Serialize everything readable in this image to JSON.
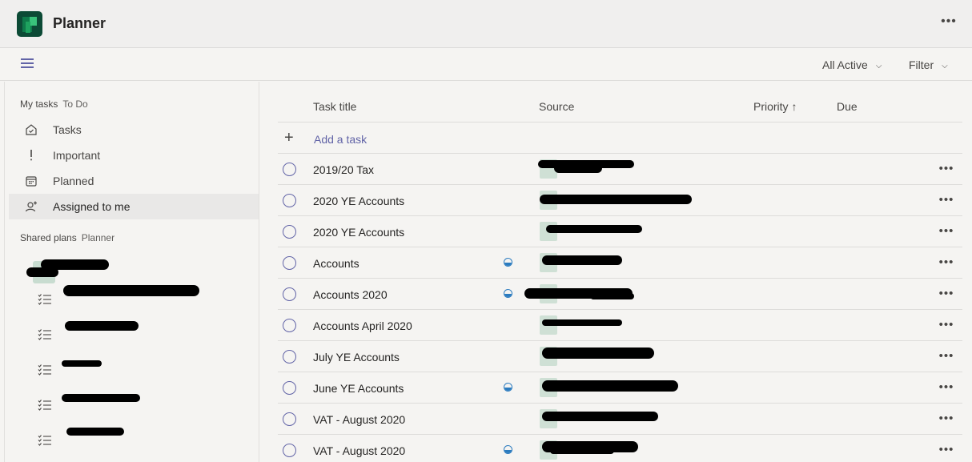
{
  "app": {
    "title": "Planner",
    "more_icon": "more-horizontal-icon",
    "logo_icon": "planner-logo-icon",
    "accent_color": "#6264a7",
    "logo_color": "#0c4a35"
  },
  "toolbar": {
    "menu_icon": "hamburger-icon",
    "filter_active_label": "All Active",
    "filter_label": "Filter",
    "chevron_icon": "chevron-down-icon"
  },
  "sidebar": {
    "my_tasks": {
      "label": "My tasks",
      "sub": "To Do",
      "items": [
        {
          "label": "Tasks",
          "icon": "home-icon",
          "selected": false
        },
        {
          "label": "Important",
          "icon": "exclamation-icon",
          "selected": false
        },
        {
          "label": "Planned",
          "icon": "calendar-icon",
          "selected": false
        },
        {
          "label": "Assigned to me",
          "icon": "person-add-icon",
          "selected": true
        }
      ]
    },
    "shared_plans": {
      "label": "Shared plans",
      "sub": "Planner",
      "items": [
        {
          "icon": "group-avatar"
        },
        {
          "icon": "checklist-icon"
        },
        {
          "icon": "checklist-icon"
        },
        {
          "icon": "checklist-icon"
        },
        {
          "icon": "checklist-icon"
        },
        {
          "icon": "checklist-icon"
        }
      ]
    }
  },
  "table": {
    "headers": {
      "title": "Task title",
      "source": "Source",
      "priority": "Priority ↑",
      "due": "Due"
    },
    "add_task_label": "Add a task",
    "add_icon": "plus-icon",
    "rows": [
      {
        "title": "2019/20 Tax",
        "in_progress": false
      },
      {
        "title": "2020 YE Accounts",
        "in_progress": false
      },
      {
        "title": "2020 YE Accounts",
        "in_progress": false
      },
      {
        "title": "Accounts",
        "in_progress": true
      },
      {
        "title": "Accounts 2020",
        "in_progress": true
      },
      {
        "title": "Accounts April 2020",
        "in_progress": false
      },
      {
        "title": "July YE Accounts",
        "in_progress": false
      },
      {
        "title": "June YE Accounts",
        "in_progress": true
      },
      {
        "title": "VAT - August 2020",
        "in_progress": false
      },
      {
        "title": "VAT - August 2020",
        "in_progress": true
      }
    ]
  }
}
